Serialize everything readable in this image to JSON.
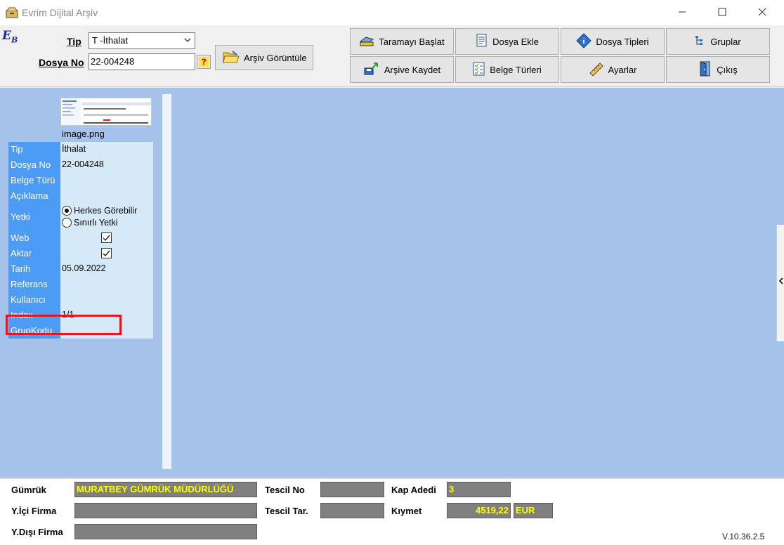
{
  "window": {
    "title": "Evrim Dijital Arşiv"
  },
  "logo": {
    "text": "E",
    "sub": "B"
  },
  "form": {
    "tip_label": "Tip",
    "tip_value": "T -İthalat",
    "dosya_label": "Dosya No",
    "dosya_value": "22-004248",
    "help_glyph": "?",
    "arsiv_button": "Arşiv Görüntüle"
  },
  "toolbar": {
    "buttons": [
      {
        "label": "Taramayı Başlat",
        "icon": "scanner-icon"
      },
      {
        "label": "Dosya Ekle",
        "icon": "file-add-icon"
      },
      {
        "label": "Dosya Tipleri",
        "icon": "info-icon"
      },
      {
        "label": "Gruplar",
        "icon": "tree-icon"
      },
      {
        "label": "Arşive Kaydet",
        "icon": "save-archive-icon"
      },
      {
        "label": "Belge Türleri",
        "icon": "checklist-icon"
      },
      {
        "label": "Ayarlar",
        "icon": "ruler-icon"
      },
      {
        "label": "Çıkış",
        "icon": "exit-door-icon"
      }
    ]
  },
  "document": {
    "thumbnail_name": "image.png",
    "properties": [
      {
        "key": "Tip",
        "value": "İthalat"
      },
      {
        "key": "Dosya No",
        "value": "22-004248"
      },
      {
        "key": "Belge Türü",
        "value": ""
      },
      {
        "key": "Açıklama",
        "value": ""
      },
      {
        "key": "Yetki",
        "options": [
          "Herkes Görebilir",
          "Sınırlı Yetki"
        ],
        "selected": "Herkes Görebilir"
      },
      {
        "key": "Web",
        "checked": true
      },
      {
        "key": "Aktar",
        "checked": true
      },
      {
        "key": "Tarih",
        "value": "05.09.2022"
      },
      {
        "key": "Referans",
        "value": ""
      },
      {
        "key": "Kullanıcı",
        "value": ""
      },
      {
        "key": "Index",
        "value": "1/1"
      },
      {
        "key": "GrupKodu",
        "value": ""
      }
    ]
  },
  "footer": {
    "gumruk_label": "Gümrük",
    "gumruk_value": "MURATBEY GÜMRÜK MÜDÜRLÜĞÜ",
    "yici_label": "Y.İçi Firma",
    "yici_value": "",
    "ydisi_label": "Y.Dışı Firma",
    "ydisi_value": "",
    "tescil_no_label": "Tescil No",
    "tescil_no_value": "",
    "tescil_tar_label": "Tescil Tar.",
    "tescil_tar_value": "",
    "kap_label": "Kap Adedi",
    "kap_value": "3",
    "kiymet_label": "Kıymet",
    "kiymet_value": "4519,22",
    "kiymet_currency": "EUR",
    "version": "V.10.36.2.5"
  },
  "colors": {
    "main_bg": "#a5c3ea",
    "prop_key_bg": "#4c9cf6",
    "prop_value_bg": "#d6e9f8",
    "highlight": "#e8141e",
    "field_text": "#ffff00",
    "field_bg": "#808080"
  }
}
